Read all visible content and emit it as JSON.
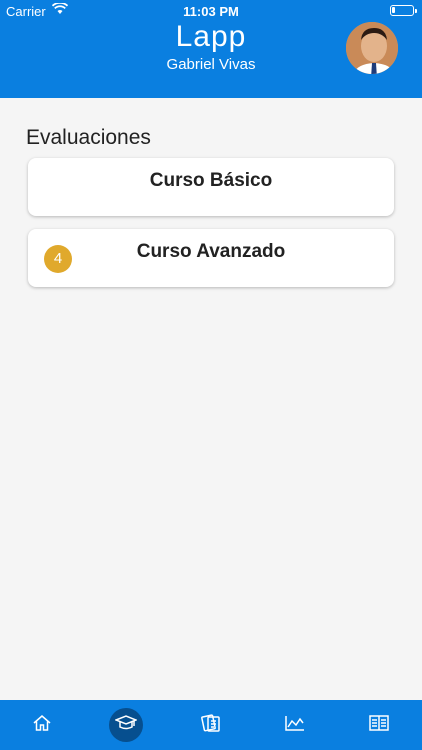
{
  "status_bar": {
    "carrier": "Carrier",
    "time": "11:03 PM",
    "battery_level": 0.15
  },
  "header": {
    "app_title": "Lapp",
    "user_name": "Gabriel Vivas"
  },
  "section": {
    "title": "Evaluaciones",
    "cards": [
      {
        "label": "Curso Básico",
        "badge": ""
      },
      {
        "label": "Curso Avanzado",
        "badge": "4"
      }
    ]
  },
  "tabbar": {
    "tabs": [
      {
        "icon": "home-icon",
        "active": false
      },
      {
        "icon": "graduation-cap-icon",
        "active": true
      },
      {
        "icon": "cards-icon",
        "active": false
      },
      {
        "icon": "chart-line-icon",
        "active": false
      },
      {
        "icon": "book-icon",
        "active": false
      }
    ]
  },
  "colors": {
    "primary": "#0a7fe0",
    "active_tab": "#064f8f",
    "badge": "#e0a92c"
  }
}
